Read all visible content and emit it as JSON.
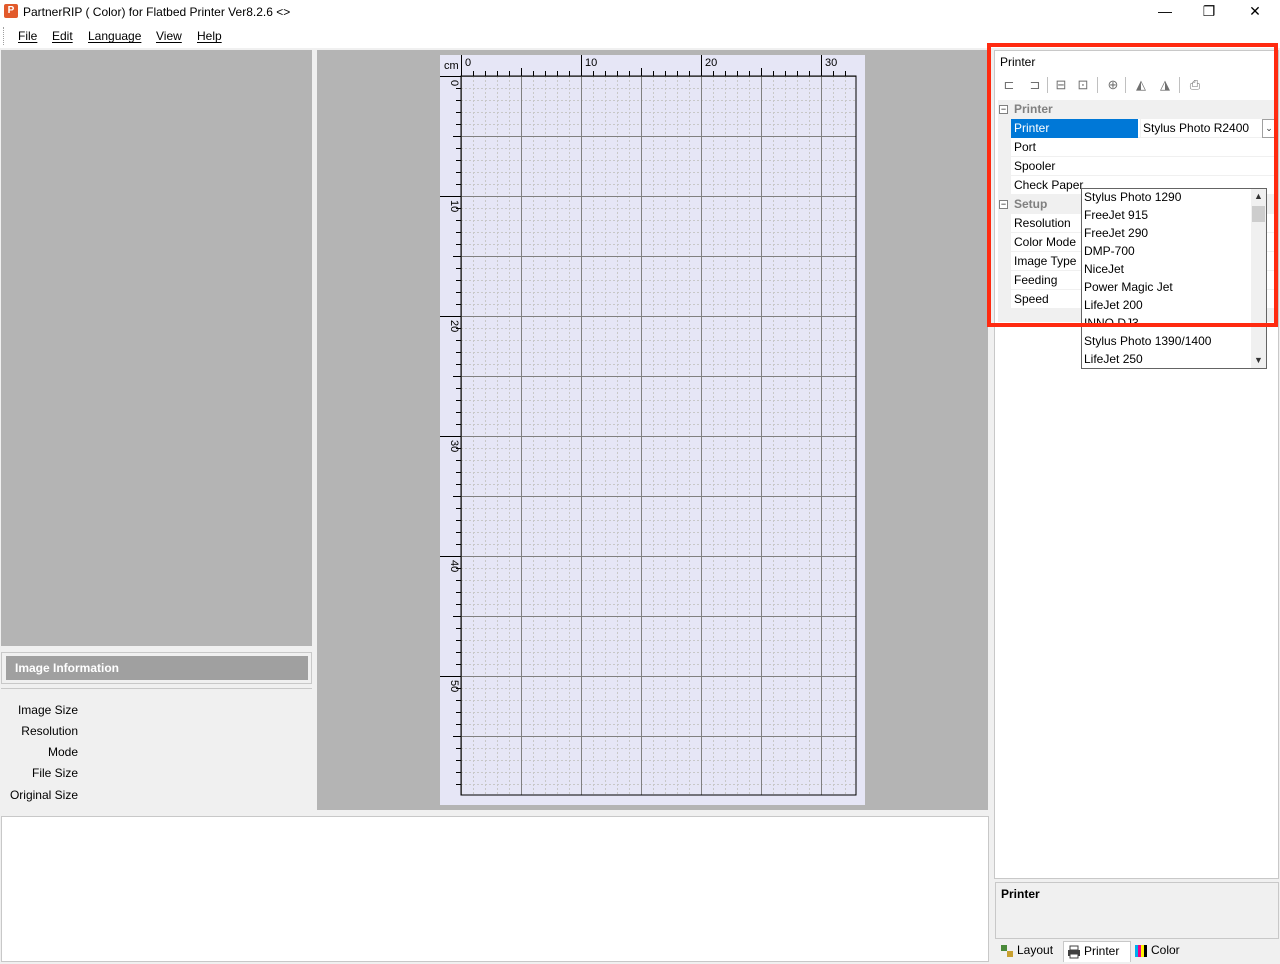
{
  "window": {
    "title": "PartnerRIP ( Color) for Flatbed Printer Ver8.2.6 <>",
    "app_icon_letter": "P",
    "controls": {
      "minimize": "—",
      "restore": "❐",
      "close": "✕"
    }
  },
  "menu": {
    "items": [
      "File",
      "Edit",
      "Language",
      "View",
      "Help"
    ]
  },
  "image_info": {
    "header": "Image Information",
    "labels": [
      "Image Size",
      "Resolution",
      "Mode",
      "File Size",
      "Original Size"
    ]
  },
  "canvas": {
    "unit": "cm",
    "top_ruler_labels": [
      "0",
      "10",
      "20",
      "30"
    ],
    "left_ruler_labels": [
      "0",
      "10",
      "20",
      "30",
      "40",
      "50"
    ]
  },
  "printer_panel": {
    "title": "Printer",
    "toolbar_icons": [
      "align-top-left-icon",
      "align-top-right-icon",
      "center-horizontal-icon",
      "center-vertical-icon",
      "center-both-icon",
      "flip-horizontal-icon",
      "flip-vertical-icon",
      "print-icon"
    ],
    "categories": [
      {
        "label": "Printer",
        "toggle": "−"
      },
      {
        "label": "Setup",
        "toggle": "−"
      }
    ],
    "properties": {
      "printer": {
        "name": "Printer",
        "value": "Stylus Photo R2400"
      },
      "port": {
        "name": "Port"
      },
      "spooler": {
        "name": "Spooler"
      },
      "check_paper": {
        "name": "Check Paper"
      },
      "resolution": {
        "name": "Resolution"
      },
      "color_mode": {
        "name": "Color Mode"
      },
      "image_type": {
        "name": "Image Type"
      },
      "feeding": {
        "name": "Feeding"
      },
      "speed": {
        "name": "Speed"
      }
    },
    "dropdown_options": [
      "Stylus Photo 1290",
      "FreeJet 915",
      "FreeJet 290",
      "DMP-700",
      "NiceJet",
      "Power Magic Jet",
      "LifeJet 200",
      "INNO DJ3",
      "Stylus Photo 1390/1400",
      "LifeJet 250"
    ],
    "combo_arrow": "⌄",
    "highlight_color": "#ff2a10"
  },
  "description": {
    "title": "Printer"
  },
  "tabs": [
    {
      "label": "Layout"
    },
    {
      "label": "Printer"
    },
    {
      "label": "Color"
    }
  ]
}
